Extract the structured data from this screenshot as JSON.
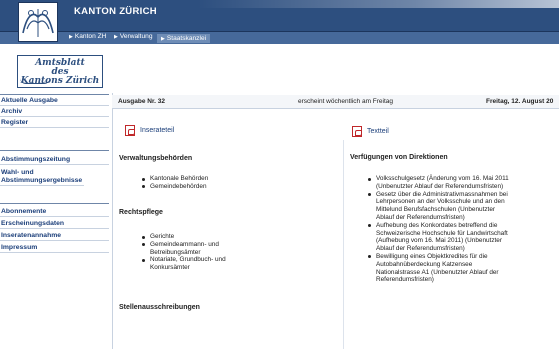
{
  "header": {
    "title": "KANTON ZÜRICH"
  },
  "breadcrumb": [
    {
      "label": "Kanton ZH"
    },
    {
      "label": "Verwaltung"
    },
    {
      "label": "Staatskanzlei"
    }
  ],
  "logo": {
    "line1": "Amtsblatt",
    "line2": "des",
    "line3": "Kantons Zürich"
  },
  "sidebar": {
    "items": [
      {
        "label": "Aktuelle Ausgabe"
      },
      {
        "label": "Archiv"
      },
      {
        "label": "Register"
      },
      {
        "label": "Abstimmungszeitung"
      },
      {
        "label": "Wahl- und Abstimmungsergebnisse"
      },
      {
        "label": "Abonnemente"
      },
      {
        "label": "Erscheinungsdaten"
      },
      {
        "label": "Inseratenannahme"
      },
      {
        "label": "Impressum"
      }
    ]
  },
  "issue": {
    "number": "Ausgabe Nr. 32",
    "frequency": "erscheint wöchentlich am Freitag",
    "date": "Freitag, 12. August 20"
  },
  "left": {
    "section_link": "Inserateteil",
    "heading1": "Verwaltungsbehörden",
    "list1": [
      "Kantonale Behörden",
      "Gemeindebehörden"
    ],
    "heading2": "Rechtspflege",
    "list2": [
      "Gerichte",
      "Gemeindeammann- und Betreibungsämter",
      "Notariate, Grundbuch- und Konkursämter"
    ],
    "heading3": "Stellenausschreibungen"
  },
  "right": {
    "section_link": "Textteil",
    "heading": "Verfügungen von Direktionen",
    "list": [
      "Volksschulgesetz (Änderung vom 16. Mai 2011 (Unbenutzter Ablauf der Referendumsfristen)",
      "Gesetz über die Administrativmassnahmen bei Lehrpersonen an der Volksschule und an den Mittelund Berufsfachschulen (Unbenutzter Ablauf der Referendumsfristen)",
      "Aufhebung des Konkordates betreffend die Schweizerische Hochschule für Landwirtschaft (Aufhebung vom 16. Mai 2011) (Unbenutzter Ablauf der Referendumsfristen)",
      "Bewilligung eines Objektkredites für die Autobahnüberdeckung Katzensee Nationalstrasse A1 (Unbenutzter Ablauf der Referendumsfristen)"
    ]
  }
}
